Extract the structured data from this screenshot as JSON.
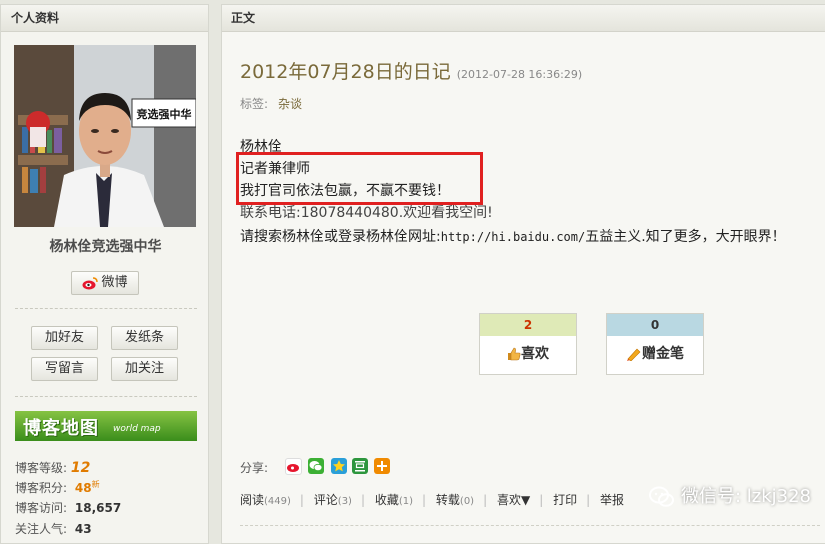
{
  "profile": {
    "header": "个人资料",
    "name": "杨林佺竞选强中华",
    "weibo_label": "微博",
    "buttons": {
      "add_friend": "加好友",
      "send_note": "发纸条",
      "write_message": "写留言",
      "follow": "加关注"
    },
    "blog_map": {
      "title": "博客地图",
      "subtitle": "world map"
    },
    "stats": [
      {
        "label": "博客等级:",
        "value": "12"
      },
      {
        "label": "博客积分:",
        "value": "48",
        "badge": "新"
      },
      {
        "label": "博客访问:",
        "value": "18,657"
      },
      {
        "label": "关注人气:",
        "value": "43"
      }
    ],
    "avatar_sign": "竞选强中华"
  },
  "post": {
    "header": "正文",
    "title": "2012年07月28日的日记",
    "timestamp": "(2012-07-28 16:36:29)",
    "tags_label": "标签:",
    "tag": "杂谈",
    "lines": [
      "杨林佺",
      "记者兼律师",
      "我打官司依法包赢，不赢不要钱！",
      "联系电话:18078440480.欢迎看我空间!",
      "请搜索杨林佺或登录杨林佺网址:"
    ],
    "url_text": "http://hi.baidu.com/",
    "line5_tail": "五益主义.知了更多，大开眼界！",
    "votes": [
      {
        "count": "2",
        "label": "喜欢"
      },
      {
        "count": "0",
        "label": "赠金笔"
      }
    ],
    "share_label": "分享:",
    "actions": [
      {
        "label": "阅读",
        "count": "(449)"
      },
      {
        "label": "评论",
        "count": "(3)"
      },
      {
        "label": "收藏",
        "count": "(1)"
      },
      {
        "label": "转载",
        "count": "(0)"
      },
      {
        "label": "喜欢▼",
        "count": ""
      },
      {
        "label": "打印",
        "count": ""
      },
      {
        "label": "举报",
        "count": ""
      }
    ]
  },
  "watermark": "微信号: lzkj328",
  "colors": {
    "highlight": "#e02020",
    "title": "#7a6a3a",
    "blogmap": "#3a8d1b"
  },
  "icons": [
    "weibo-icon",
    "thumbs-up-icon",
    "golden-pen-icon",
    "wechat-icon"
  ]
}
